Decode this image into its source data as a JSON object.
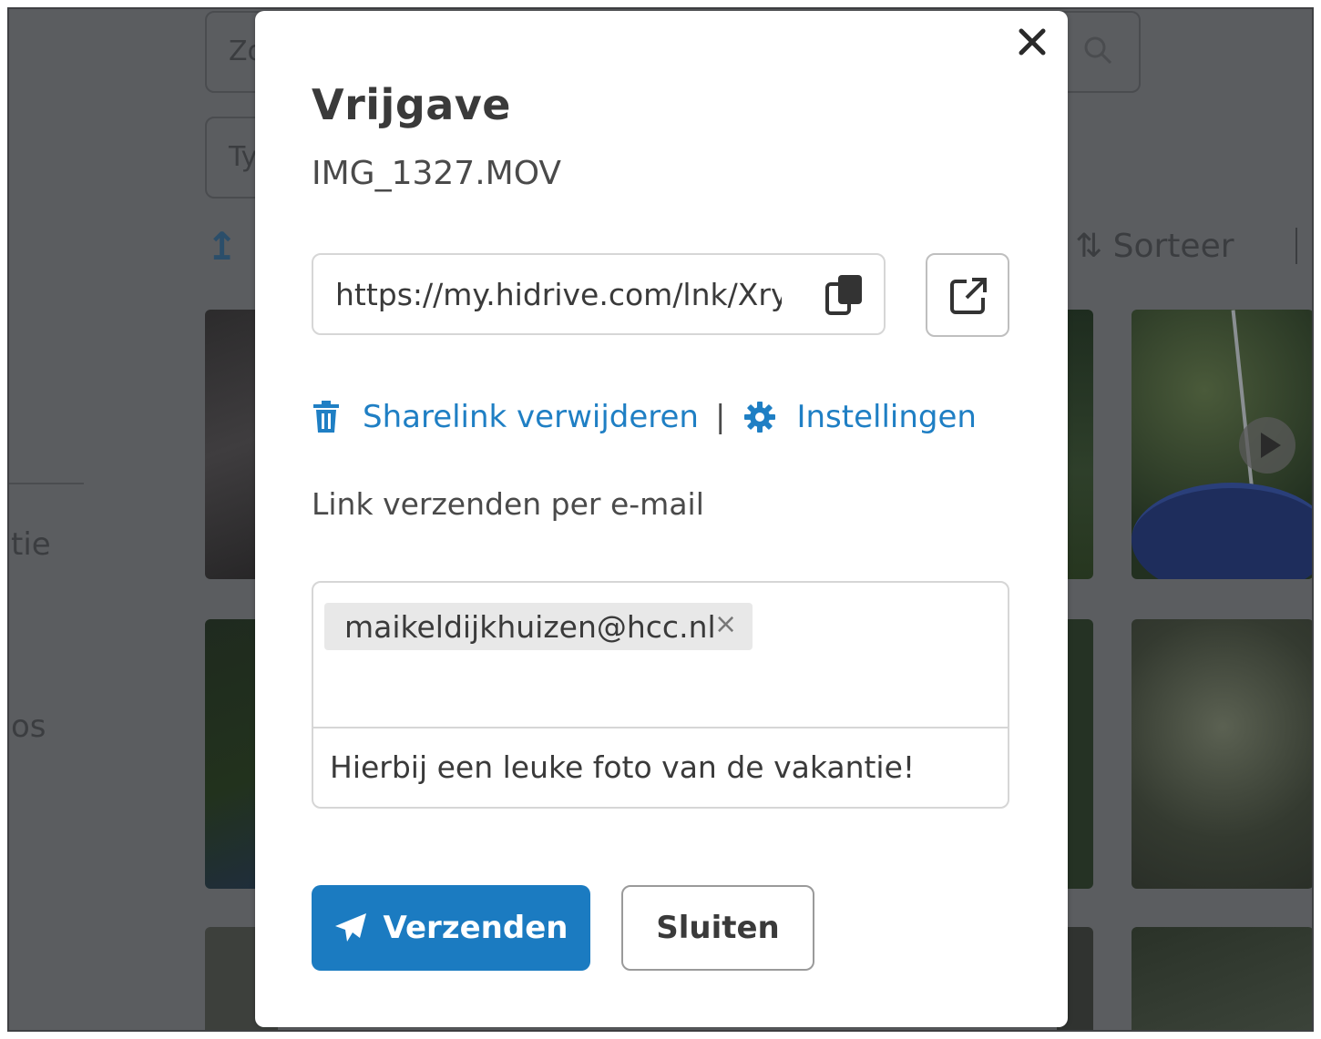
{
  "background": {
    "search_text": "Zo",
    "type_text": "Ty",
    "sort_label": "Sorteer",
    "sidebar_a": "tie",
    "sidebar_b": "os"
  },
  "dialog": {
    "title": "Vrijgave",
    "filename": "IMG_1327.MOV",
    "share_link": "https://my.hidrive.com/lnk/XrycC",
    "delete_link_label": "Sharelink verwijderen",
    "separator": "|",
    "settings_label": "Instellingen",
    "email_section_label": "Link verzenden per e-mail",
    "recipient": "maikeldijkhuizen@hcc.nl",
    "chip_remove": "×",
    "message": "Hierbij een leuke foto van de vakantie!",
    "send_label": "Verzenden",
    "close_label": "Sluiten"
  },
  "icons": {
    "close": "close-icon",
    "copy": "copy-icon",
    "open_external": "external-link-icon",
    "delete": "trash-icon",
    "settings": "gear-icon",
    "send": "paper-plane-icon"
  },
  "colors": {
    "accent": "#1b7bc1",
    "link": "#1f7fc4",
    "overlay": "#5b5d60"
  }
}
